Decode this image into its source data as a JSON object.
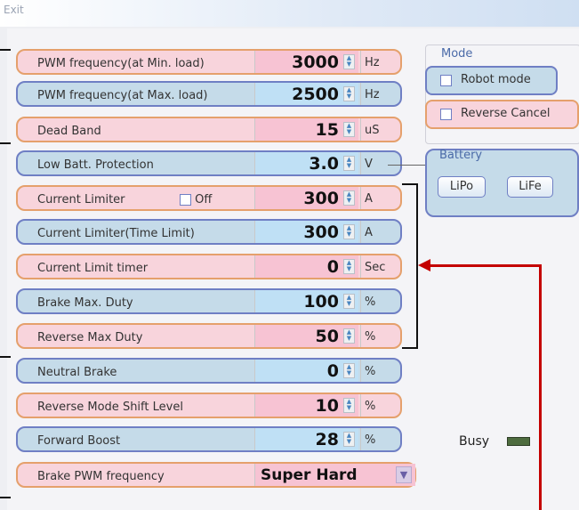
{
  "window": {
    "title": "Exit"
  },
  "rows": [
    {
      "label": "PWM frequency(at Min. load)",
      "value": "3000",
      "unit": "Hz",
      "color": "pink"
    },
    {
      "label": "PWM frequency(at Max. load)",
      "value": "2500",
      "unit": "Hz",
      "color": "blue"
    },
    {
      "label": "Dead Band",
      "value": "15",
      "unit": "uS",
      "color": "pink"
    },
    {
      "label": "Low Batt. Protection",
      "value": "3.0",
      "unit": "V",
      "color": "blue"
    },
    {
      "label": "Current Limiter",
      "value": "300",
      "unit": "A",
      "color": "pink",
      "checkbox_label": "Off"
    },
    {
      "label": "Current Limiter(Time Limit)",
      "value": "300",
      "unit": "A",
      "color": "blue"
    },
    {
      "label": "Current Limit timer",
      "value": "0",
      "unit": "Sec",
      "color": "pink"
    },
    {
      "label": "Brake Max. Duty",
      "value": "100",
      "unit": "%",
      "color": "blue"
    },
    {
      "label": "Reverse Max Duty",
      "value": "50",
      "unit": "%",
      "color": "pink"
    },
    {
      "label": "Neutral Brake",
      "value": "0",
      "unit": "%",
      "color": "blue"
    },
    {
      "label": "Reverse Mode Shift Level",
      "value": "10",
      "unit": "%",
      "color": "pink"
    },
    {
      "label": "Forward Boost",
      "value": "28",
      "unit": "%",
      "color": "blue"
    }
  ],
  "brake_pwm": {
    "label": "Brake PWM frequency",
    "value": "Super Hard"
  },
  "mode": {
    "title": "Mode",
    "robot_mode": "Robot mode",
    "reverse_cancel": "Reverse Cancel"
  },
  "battery": {
    "title": "Battery",
    "lipo": "LiPo",
    "life": "LiFe"
  },
  "status": {
    "busy_label": "Busy"
  },
  "colors": {
    "pink_bg": "#f8d4dc",
    "blue_bg": "#c5dbe9",
    "pink_border": "#e5a06c",
    "blue_border": "#6f7fc4",
    "red_arrow": "#c40000"
  }
}
